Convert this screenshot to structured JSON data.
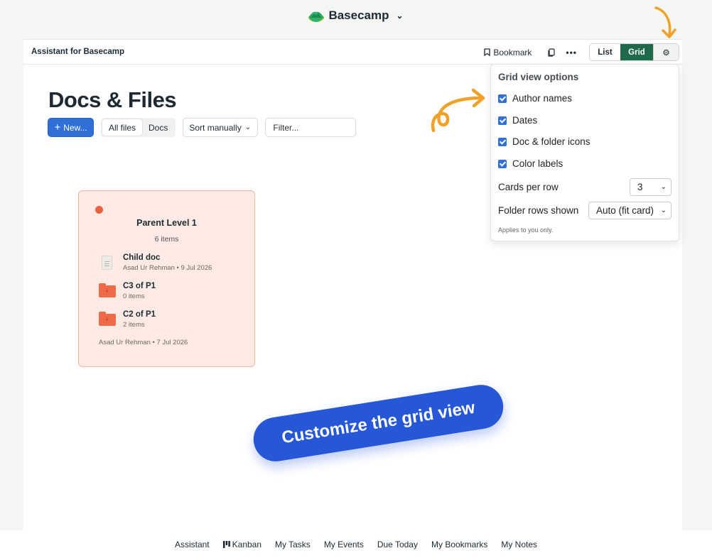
{
  "brand": {
    "name": "Basecamp"
  },
  "panel_header": {
    "title": "Assistant for Basecamp",
    "bookmark_label": "Bookmark",
    "view_list": "List",
    "view_grid": "Grid"
  },
  "page": {
    "title": "Docs & Files"
  },
  "toolbar": {
    "new_label": "New...",
    "filters": [
      "All files",
      "Docs"
    ],
    "sort_label": "Sort manually",
    "filter_placeholder": "Filter..."
  },
  "card": {
    "title": "Parent Level 1",
    "count": "6 items",
    "label_color": "#ec6240",
    "items": [
      {
        "type": "doc",
        "name": "Child doc",
        "sub": "Asad Ur Rehman • 9 Jul 2026"
      },
      {
        "type": "folder",
        "name": "C3 of P1",
        "sub": "0 items"
      },
      {
        "type": "folder",
        "name": "C2 of P1",
        "sub": "2 items"
      }
    ],
    "footer": "Asad Ur Rehman • 7 Jul 2026"
  },
  "grid_options": {
    "title": "Grid view options",
    "checks": [
      "Author names",
      "Dates",
      "Doc & folder icons",
      "Color labels"
    ],
    "cards_per_row_label": "Cards per row",
    "cards_per_row_value": "3",
    "folder_rows_label": "Folder rows shown",
    "folder_rows_value": "Auto (fit card)",
    "note": "Applies to you only."
  },
  "annotation": {
    "text": "Customize the grid view"
  },
  "bottom_nav": [
    "Assistant",
    "Kanban",
    "My Tasks",
    "My Events",
    "Due Today",
    "My Bookmarks",
    "My Notes"
  ],
  "colors": {
    "accent_blue": "#2f6fd6",
    "grid_green": "#1f6a4a",
    "arrow_orange": "#f0a12a"
  }
}
